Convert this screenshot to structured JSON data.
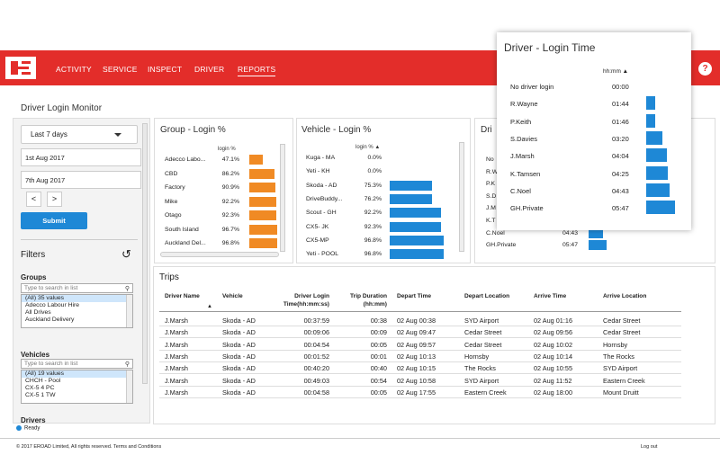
{
  "colors": {
    "brand": "#e32d2a",
    "accent": "#1e88d6",
    "orange": "#f08a24"
  },
  "nav": {
    "items": [
      "ACTIVITY",
      "SERVICE",
      "INSPECT",
      "DRIVER",
      "REPORTS"
    ],
    "active": "REPORTS",
    "help": "?"
  },
  "page": {
    "title": "Driver Login Monitor"
  },
  "left": {
    "period": "Last 7 days",
    "date_from": "1st Aug 2017",
    "date_to": "7th Aug 2017",
    "prev": "<",
    "next": ">",
    "submit": "Submit",
    "filters_title": "Filters",
    "reset_icon": "↺",
    "groups": {
      "title": "Groups",
      "placeholder": "Type to search in list",
      "items": [
        "(All) 35 values",
        "Adecco Labour Hire",
        "All Drives",
        "Auckland Delivery"
      ]
    },
    "vehicles": {
      "title": "Vehicles",
      "placeholder": "Type to search in list",
      "items": [
        "(All) 19 values",
        "CHCH - Pool",
        "CX-5 4 PC",
        "CX-5 1 TW"
      ]
    },
    "drivers": {
      "title": "Drivers"
    }
  },
  "group_card": {
    "title": "Group - Login %",
    "col_header": "login %",
    "rows": [
      {
        "label": "Adecco Labo...",
        "value": "47.1%",
        "pct": 47.1
      },
      {
        "label": "CBD",
        "value": "86.2%",
        "pct": 86.2
      },
      {
        "label": "Factory",
        "value": "90.9%",
        "pct": 90.9
      },
      {
        "label": "Mike",
        "value": "92.2%",
        "pct": 92.2
      },
      {
        "label": "Otago",
        "value": "92.3%",
        "pct": 92.3
      },
      {
        "label": "South Island",
        "value": "96.7%",
        "pct": 96.7
      },
      {
        "label": "Auckland Del...",
        "value": "96.8%",
        "pct": 96.8
      }
    ]
  },
  "vehicle_card": {
    "title": "Vehicle - Login %",
    "col_header": "login % ▲",
    "rows": [
      {
        "label": "Kuga - MA",
        "value": "0.0%",
        "pct": 0
      },
      {
        "label": "Yeti - KH",
        "value": "0.0%",
        "pct": 0
      },
      {
        "label": "Skoda - AD",
        "value": "75.3%",
        "pct": 75.3
      },
      {
        "label": "DriveBuddy...",
        "value": "76.2%",
        "pct": 76.2
      },
      {
        "label": "Scout - GH",
        "value": "92.2%",
        "pct": 92.2
      },
      {
        "label": "CX5- JK",
        "value": "92.3%",
        "pct": 92.3
      },
      {
        "label": "CX5-MP",
        "value": "96.8%",
        "pct": 96.8
      },
      {
        "label": "Yeti - POOL",
        "value": "96.8%",
        "pct": 96.8
      }
    ]
  },
  "driver_card": {
    "title_fragment": "Dri",
    "rows": [
      {
        "label": "No",
        "value": "",
        "minutes": 0
      },
      {
        "label": "R.W",
        "value": "",
        "minutes": 104
      },
      {
        "label": "P.K",
        "value": "",
        "minutes": 106
      },
      {
        "label": "S.D",
        "value": "",
        "minutes": 200
      },
      {
        "label": "J.M",
        "value": "",
        "minutes": 244
      },
      {
        "label": "K.T",
        "value": "",
        "minutes": 265
      },
      {
        "label": "C.Noel",
        "value": "04:43",
        "minutes": 283
      },
      {
        "label": "GH.Private",
        "value": "05:47",
        "minutes": 347
      }
    ]
  },
  "popup": {
    "title": "Driver - Login Time",
    "col_header": "hh:mm ▲",
    "rows": [
      {
        "label": "No driver login",
        "value": "00:00",
        "minutes": 0
      },
      {
        "label": "R.Wayne",
        "value": "01:44",
        "minutes": 104
      },
      {
        "label": "P.Keith",
        "value": "01:46",
        "minutes": 106
      },
      {
        "label": "S.Davies",
        "value": "03:20",
        "minutes": 200
      },
      {
        "label": "J.Marsh",
        "value": "04:04",
        "minutes": 244
      },
      {
        "label": "K.Tamsen",
        "value": "04:25",
        "minutes": 265
      },
      {
        "label": "C.Noel",
        "value": "04:43",
        "minutes": 283
      },
      {
        "label": "GH.Private",
        "value": "05:47",
        "minutes": 347
      }
    ]
  },
  "trips": {
    "title": "Trips",
    "headers": {
      "driver": "Driver Name",
      "vehicle": "Vehicle",
      "login_time": "Driver Login Time(hh:mm:ss)",
      "duration": "Trip Duration (hh:mm)",
      "depart_time": "Depart Time",
      "depart_loc": "Depart Location",
      "arrive_time": "Arrive Time",
      "arrive_loc": "Arrive Location"
    },
    "sort_indicator": "▲",
    "rows": [
      {
        "driver": "J.Marsh",
        "vehicle": "Skoda - AD",
        "login": "00:37:59",
        "dur": "00:38",
        "dtime": "02 Aug 00:38",
        "dloc": "SYD Airport",
        "atime": "02 Aug 01:16",
        "aloc": "Cedar Street"
      },
      {
        "driver": "J.Marsh",
        "vehicle": "Skoda - AD",
        "login": "00:09:06",
        "dur": "00:09",
        "dtime": "02 Aug 09:47",
        "dloc": "Cedar Street",
        "atime": "02 Aug 09:56",
        "aloc": "Cedar Street"
      },
      {
        "driver": "J.Marsh",
        "vehicle": "Skoda - AD",
        "login": "00:04:54",
        "dur": "00:05",
        "dtime": "02 Aug 09:57",
        "dloc": "Cedar Street",
        "atime": "02 Aug 10:02",
        "aloc": "Hornsby"
      },
      {
        "driver": "J.Marsh",
        "vehicle": "Skoda - AD",
        "login": "00:01:52",
        "dur": "00:01",
        "dtime": "02 Aug 10:13",
        "dloc": "Hornsby",
        "atime": "02 Aug 10:14",
        "aloc": "The Rocks"
      },
      {
        "driver": "J.Marsh",
        "vehicle": "Skoda - AD",
        "login": "00:40:20",
        "dur": "00:40",
        "dtime": "02 Aug 10:15",
        "dloc": "The Rocks",
        "atime": "02 Aug 10:55",
        "aloc": "SYD Airport"
      },
      {
        "driver": "J.Marsh",
        "vehicle": "Skoda - AD",
        "login": "00:49:03",
        "dur": "00:54",
        "dtime": "02 Aug 10:58",
        "dloc": "SYD Airport",
        "atime": "02 Aug 11:52",
        "aloc": "Eastern Creek"
      },
      {
        "driver": "J.Marsh",
        "vehicle": "Skoda - AD",
        "login": "00:04:58",
        "dur": "00:05",
        "dtime": "02 Aug 17:55",
        "dloc": "Eastern Creek",
        "atime": "02 Aug 18:00",
        "aloc": "Mount Druitt"
      }
    ]
  },
  "status": {
    "ready": "Ready"
  },
  "footer": {
    "copyright": "© 2017 EROAD Limited, All rights reserved.",
    "terms": "Terms and Conditions",
    "logout": "Log out"
  }
}
